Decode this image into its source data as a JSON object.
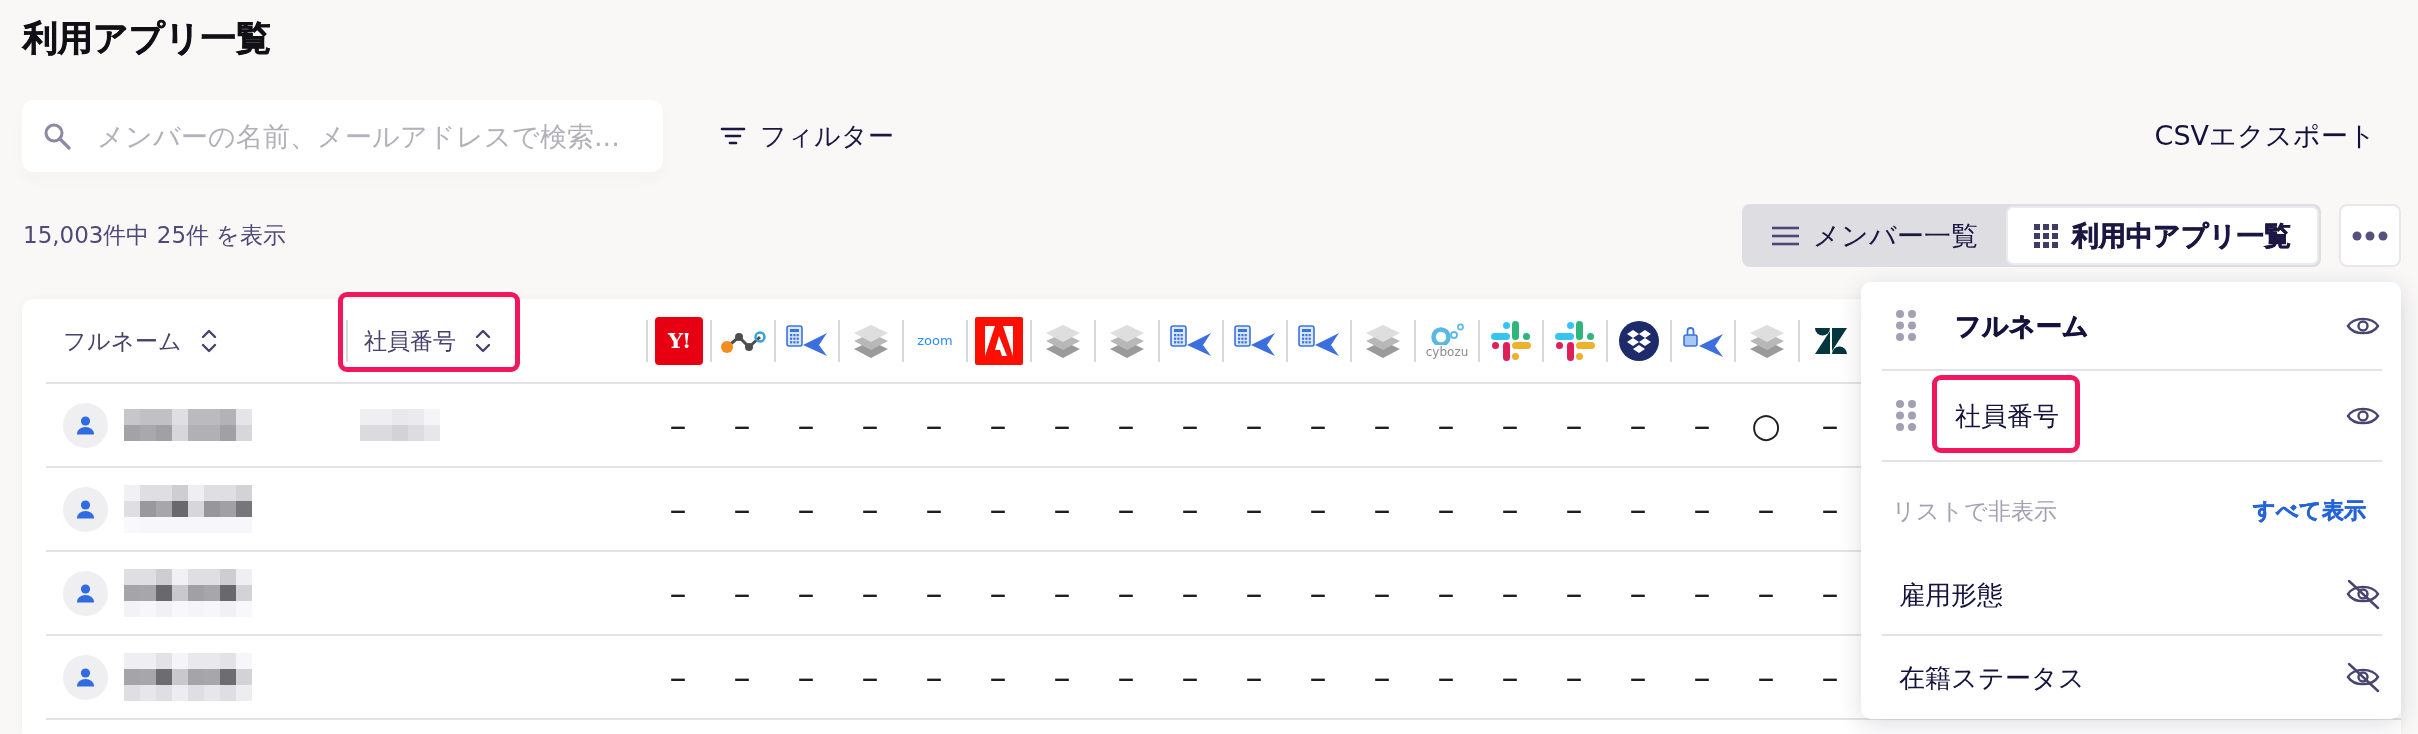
{
  "page": {
    "title": "利用アプリ一覧"
  },
  "search": {
    "placeholder": "メンバーの名前、メールアドレスで検索..."
  },
  "filter_button": {
    "label": "フィルター"
  },
  "export_button": {
    "label": "CSVエクスポート"
  },
  "result_count": "15,003件中 25件 を表示",
  "view_tabs": [
    {
      "label": "メンバー一覧",
      "selected": false
    },
    {
      "label": "利用中アプリ一覧",
      "selected": true
    }
  ],
  "table": {
    "columns": [
      {
        "label": "フルネーム",
        "sortable": true,
        "highlighted": false
      },
      {
        "label": "社員番号",
        "sortable": true,
        "highlighted": true
      }
    ],
    "app_columns": [
      {
        "kind": "y-tile",
        "logo_text": "Y!"
      },
      {
        "kind": "nodes"
      },
      {
        "kind": "calculator-plane"
      },
      {
        "kind": "layers"
      },
      {
        "kind": "wordmark",
        "logo_text": "zoom"
      },
      {
        "kind": "a-tile"
      },
      {
        "kind": "layers"
      },
      {
        "kind": "layers"
      },
      {
        "kind": "calculator-plane"
      },
      {
        "kind": "calculator-plane"
      },
      {
        "kind": "calculator-plane"
      },
      {
        "kind": "layers"
      },
      {
        "kind": "rings",
        "logo_text": "cybozu"
      },
      {
        "kind": "hash"
      },
      {
        "kind": "hash"
      },
      {
        "kind": "box-circle"
      },
      {
        "kind": "lock-plane"
      },
      {
        "kind": "layers"
      },
      {
        "kind": "z-mark"
      }
    ],
    "rows": [
      {
        "name_blurred": true,
        "employee_number_blurred": true,
        "apps": [
          "–",
          "–",
          "–",
          "–",
          "–",
          "–",
          "–",
          "–",
          "–",
          "–",
          "–",
          "–",
          "–",
          "–",
          "–",
          "–",
          "–",
          "○",
          "–"
        ]
      },
      {
        "name_blurred": true,
        "employee_number_blurred": false,
        "apps": [
          "–",
          "–",
          "–",
          "–",
          "–",
          "–",
          "–",
          "–",
          "–",
          "–",
          "–",
          "–",
          "–",
          "–",
          "–",
          "–",
          "–",
          "–",
          "–"
        ]
      },
      {
        "name_blurred": true,
        "employee_number_blurred": false,
        "apps": [
          "–",
          "–",
          "–",
          "–",
          "–",
          "–",
          "–",
          "–",
          "–",
          "–",
          "–",
          "–",
          "–",
          "–",
          "–",
          "–",
          "–",
          "–",
          "–"
        ]
      },
      {
        "name_blurred": true,
        "employee_number_blurred": false,
        "apps": [
          "–",
          "–",
          "–",
          "–",
          "–",
          "–",
          "–",
          "–",
          "–",
          "–",
          "–",
          "–",
          "–",
          "–",
          "–",
          "–",
          "–",
          "–",
          "–"
        ]
      }
    ]
  },
  "column_menu": {
    "shown_items": [
      {
        "label": "フルネーム",
        "visible": true,
        "fixed": true,
        "highlighted": false
      },
      {
        "label": "社員番号",
        "visible": true,
        "fixed": false,
        "highlighted": true
      }
    ],
    "hidden_heading": "リストで非表示",
    "show_all_link": "すべて表示",
    "hidden_items": [
      {
        "label": "雇用形態",
        "visible": false
      },
      {
        "label": "在籍ステータス",
        "visible": false
      }
    ]
  }
}
